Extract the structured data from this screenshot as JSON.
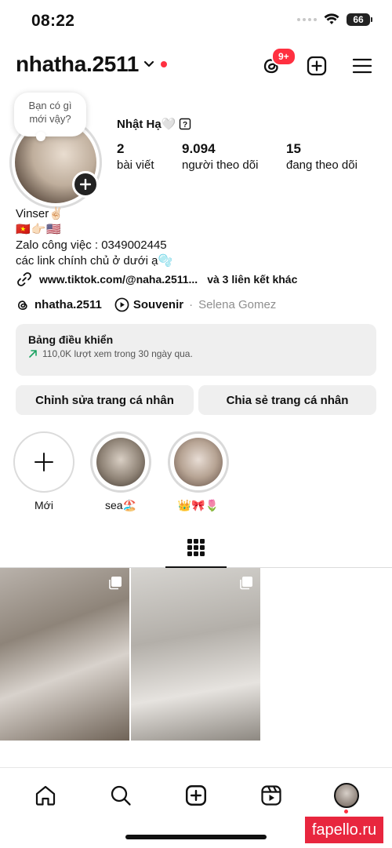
{
  "status_bar": {
    "time": "08:22",
    "battery": "66"
  },
  "header": {
    "username": "nhatha.2511",
    "notification_count": "9+"
  },
  "profile": {
    "note": "Bạn có gì mới vậy?",
    "full_name": "Nhật Hạ🤍",
    "posts_count": "2",
    "posts_label": "bài viết",
    "followers_count": "9.094",
    "followers_label": "người theo dõi",
    "following_count": "15",
    "following_label": "đang theo dõi",
    "bio": {
      "line1": "Vinser✌🏻",
      "line2": "🇻🇳👉🏻🇺🇸",
      "line3": "Zalo công việc : 0349002445",
      "line4": "các link chính chủ ở dưới ạ🫧"
    },
    "link_text": "www.tiktok.com/@naha.2511...",
    "link_extra": "và 3 liên kết khác",
    "threads_handle": "nhatha.2511",
    "music_title": "Souvenir",
    "music_separator": "·",
    "music_artist": "Selena Gomez"
  },
  "dashboard": {
    "title": "Bảng điều khiển",
    "subtitle": "110,0K lượt xem trong 30 ngày qua."
  },
  "buttons": {
    "edit_profile": "Chỉnh sửa trang cá nhân",
    "share_profile": "Chia sẻ trang cá nhân"
  },
  "highlights": [
    {
      "label": "Mới"
    },
    {
      "label": "sea🏖️"
    },
    {
      "label": "👑🎀🌷"
    }
  ],
  "watermark": "fapello.ru",
  "colors": {
    "accent_red": "#ff3040",
    "button_bg": "#efefef",
    "muted": "#8e8e8e"
  }
}
